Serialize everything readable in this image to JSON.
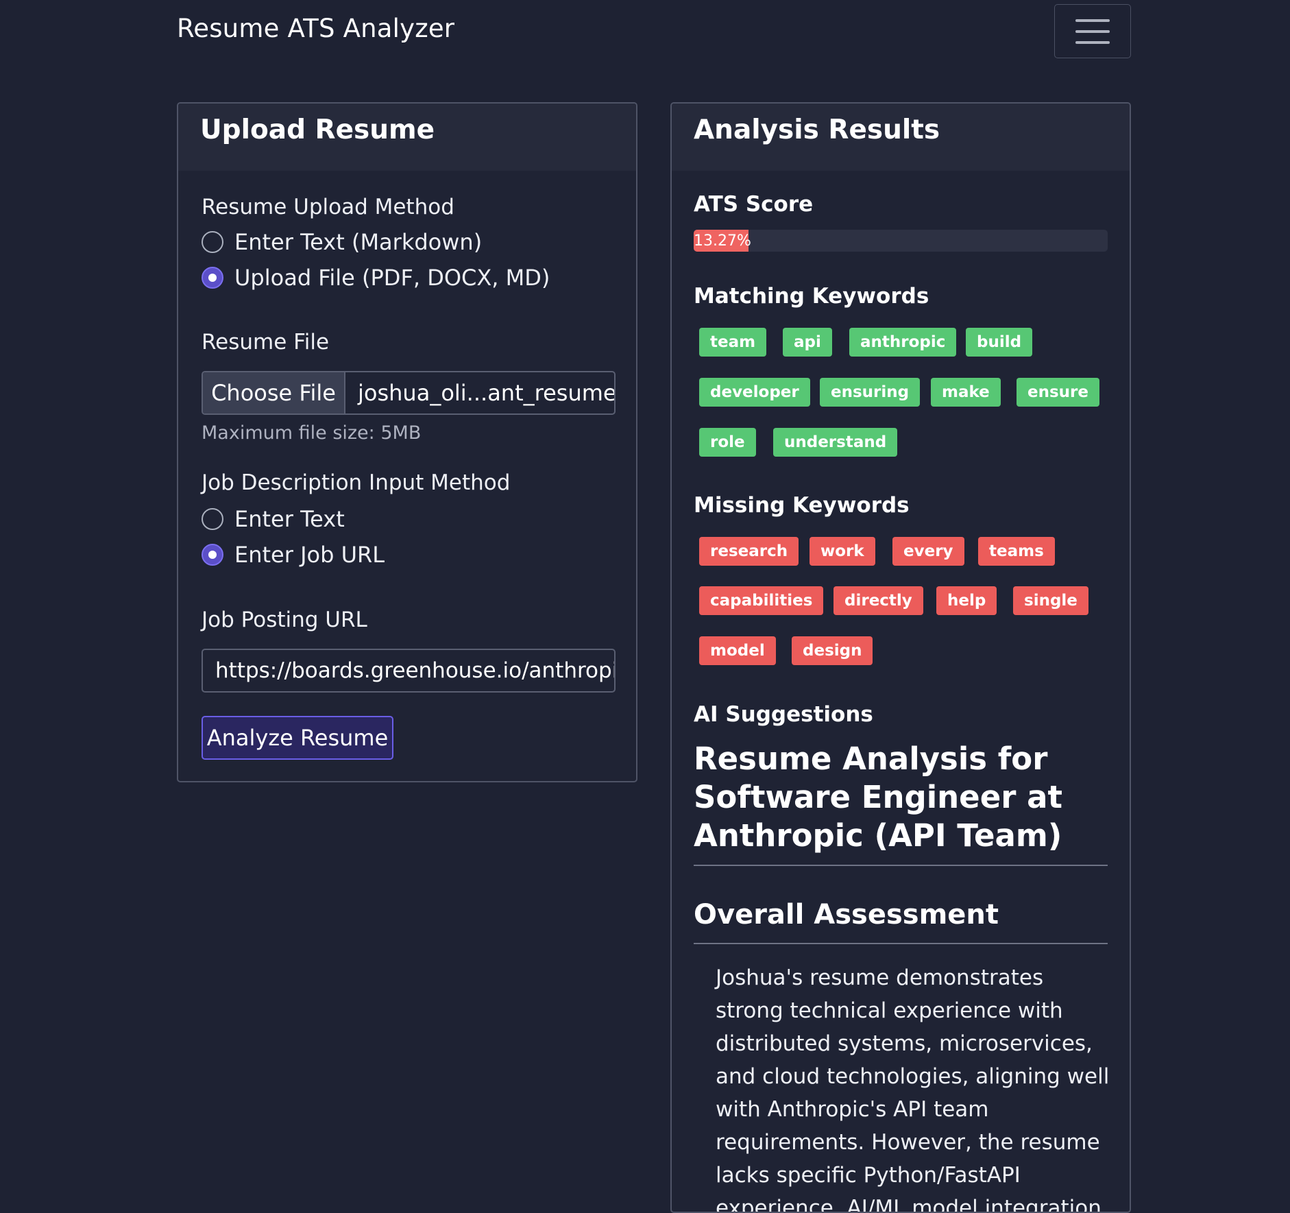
{
  "navbar": {
    "brand": "Resume ATS Analyzer",
    "menu_icon": "hamburger-menu-icon"
  },
  "upload": {
    "title": "Upload Resume",
    "resume_method_label": "Resume Upload Method",
    "resume_methods": [
      {
        "label": "Enter Text (Markdown)",
        "checked": false
      },
      {
        "label": "Upload File (PDF, DOCX, MD)",
        "checked": true
      }
    ],
    "resume_file_label": "Resume File",
    "choose_file_button": "Choose File",
    "file_name": "joshua_oli...ant_resume",
    "file_help": "Maximum file size: 5MB",
    "job_method_label": "Job Description Input Method",
    "job_methods": [
      {
        "label": "Enter Text",
        "checked": false
      },
      {
        "label": "Enter Job URL",
        "checked": true
      }
    ],
    "job_url_label": "Job Posting URL",
    "job_url_value": "https://boards.greenhouse.io/anthropic",
    "analyze_button": "Analyze Resume"
  },
  "results": {
    "title": "Analysis Results",
    "ats_score_label": "ATS Score",
    "ats_score_text": "13.27%",
    "ats_score_value": 13.27,
    "matching_label": "Matching Keywords",
    "matching_keywords": [
      "team",
      "api",
      "anthropic",
      "build",
      "developer",
      "ensuring",
      "make",
      "ensure",
      "role",
      "understand"
    ],
    "missing_label": "Missing Keywords",
    "missing_keywords": [
      "research",
      "work",
      "every",
      "teams",
      "capabilities",
      "directly",
      "help",
      "single",
      "model",
      "design"
    ],
    "ai_suggestions_label": "AI Suggestions",
    "ai_heading": "Resume Analysis for Software Engineer at Anthropic (API Team)",
    "overall_heading": "Overall Assessment",
    "overall_text": "Joshua's resume demonstrates strong technical experience with distributed systems, microservices, and cloud technologies, aligning well with Anthropic's API team requirements. However, the resume lacks specific Python/FastAPI experience, AI/ML model integration work, and"
  },
  "colors": {
    "background": "#1e2233",
    "matching_badge": "#57c774",
    "missing_badge": "#ec5c5a",
    "progress_fill": "#ef6461",
    "primary_accent": "#6a5ee6"
  }
}
